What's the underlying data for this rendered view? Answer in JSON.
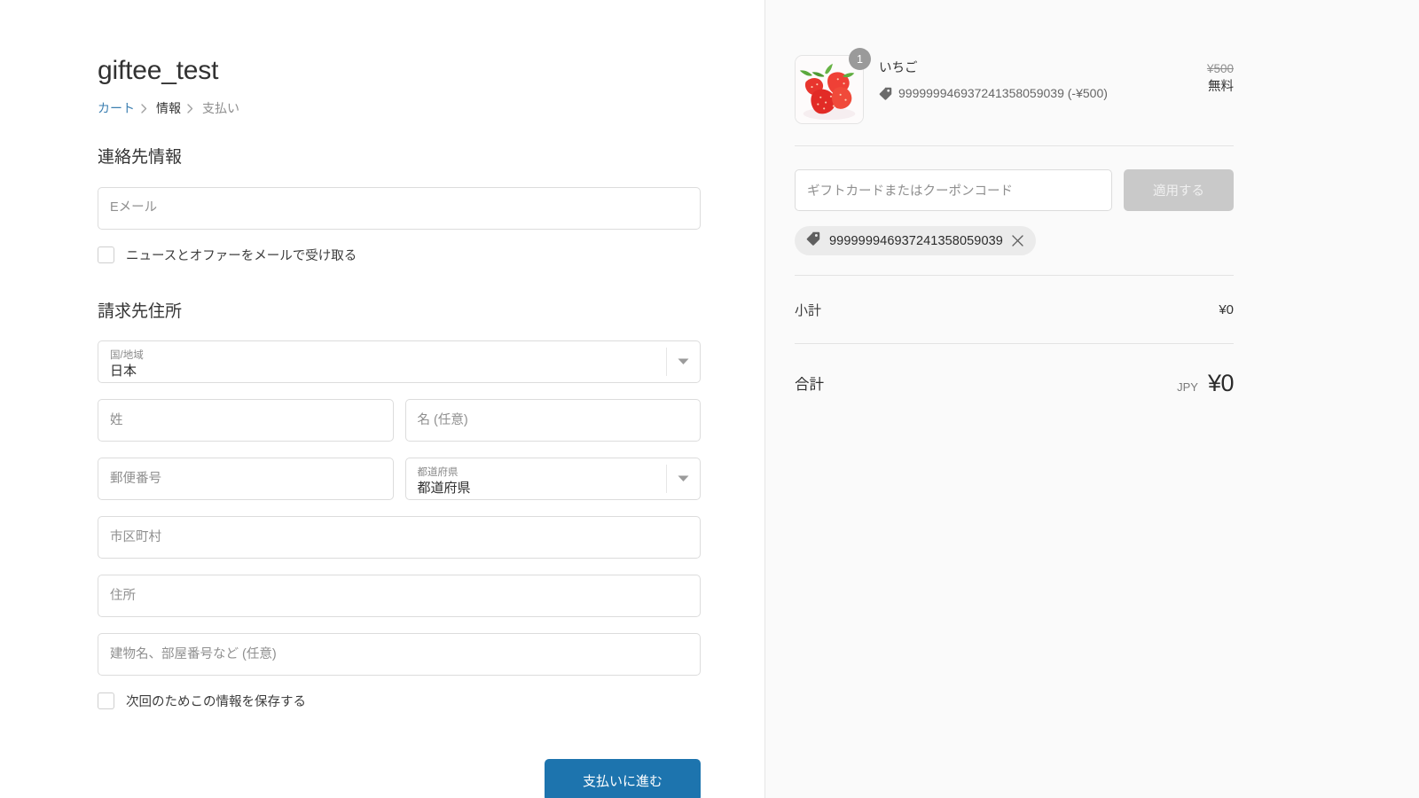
{
  "shop": {
    "title": "giftee_test"
  },
  "breadcrumb": {
    "cart": "カート",
    "information": "情報",
    "payment": "支払い",
    "separator_icon": "chevron-right-icon"
  },
  "contact": {
    "section_title": "連絡先情報",
    "email_placeholder": "Eメール",
    "newsletter_label": "ニュースとオファーをメールで受け取る",
    "newsletter_checked": false
  },
  "billing": {
    "section_title": "請求先住所",
    "country": {
      "label": "国/地域",
      "value": "日本",
      "caret_icon": "chevron-down-icon"
    },
    "last_name_placeholder": "姓",
    "first_name_placeholder": "名 (任意)",
    "postal_code_placeholder": "郵便番号",
    "prefecture": {
      "label": "都道府県",
      "value": "都道府県",
      "caret_icon": "chevron-down-icon"
    },
    "city_placeholder": "市区町村",
    "address_placeholder": "住所",
    "address2_placeholder": "建物名、部屋番号など (任意)",
    "save_info_label": "次回のためこの情報を保存する",
    "save_info_checked": false
  },
  "submit": {
    "label": "支払いに進む",
    "color": "#1d74ae"
  },
  "summary": {
    "line_items": [
      {
        "name": "いちご",
        "quantity": "1",
        "thumbnail_icon": "strawberry-photo",
        "discount_icon": "tag-icon",
        "discount_text": "999999946937241358059039 (-¥500)",
        "original_price": "¥500",
        "final_price": "無料"
      }
    ],
    "discount": {
      "input_placeholder": "ギフトカードまたはクーポンコード",
      "input_value": "",
      "apply_label": "適用する",
      "apply_disabled": true,
      "applied_codes": [
        {
          "icon": "tag-icon",
          "code": "999999946937241358059039",
          "remove_icon": "close-icon"
        }
      ]
    },
    "subtotal": {
      "label": "小計",
      "value": "¥0"
    },
    "total": {
      "label": "合計",
      "currency": "JPY",
      "value": "¥0"
    }
  }
}
